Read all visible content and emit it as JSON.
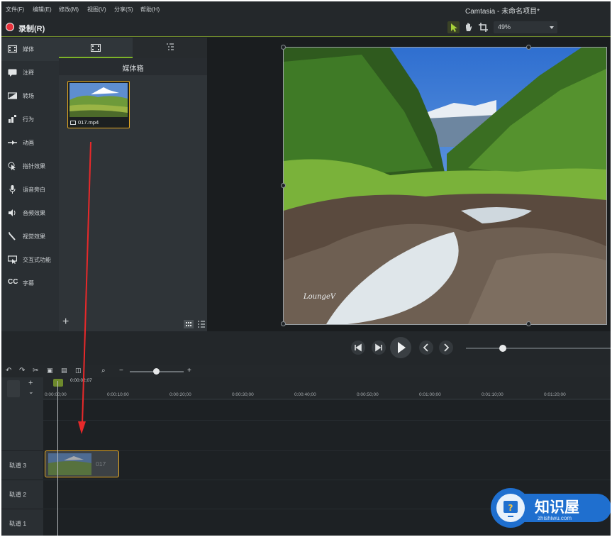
{
  "menubar": {
    "items": [
      "文件(F)",
      "编辑(E)",
      "修改(M)",
      "视图(V)",
      "分享(S)",
      "帮助(H)"
    ],
    "title": "Camtasia - 未命名项目*"
  },
  "toolbar": {
    "record_label": "录制(R)",
    "zoom_value": "49%"
  },
  "sidebar": {
    "items": [
      {
        "label": "媒体",
        "icon": "film-icon"
      },
      {
        "label": "注释",
        "icon": "annotation-icon"
      },
      {
        "label": "转场",
        "icon": "transition-icon"
      },
      {
        "label": "行为",
        "icon": "behavior-icon"
      },
      {
        "label": "动画",
        "icon": "animation-icon"
      },
      {
        "label": "指针效果",
        "icon": "cursor-effect-icon"
      },
      {
        "label": "语音旁白",
        "icon": "microphone-icon"
      },
      {
        "label": "音频效果",
        "icon": "speaker-icon"
      },
      {
        "label": "视觉效果",
        "icon": "magic-wand-icon"
      },
      {
        "label": "交互式功能",
        "icon": "interactive-icon"
      },
      {
        "label": "字幕",
        "icon": "cc-icon"
      }
    ]
  },
  "media_bin": {
    "header": "媒体箱",
    "clip_name": "017.mp4"
  },
  "preview": {
    "watermark": "LoungeV"
  },
  "timeline": {
    "playhead_time": "0:00:02;07",
    "ticks": [
      "0:00:00;00",
      "0:00:10;00",
      "0:00:20;00",
      "0:00:30;00",
      "0:00:40;00",
      "0:00:50;00",
      "0:01:00;00",
      "0:01:10;00",
      "0:01:20;00"
    ],
    "tracks": [
      "轨道 3",
      "轨道 2",
      "轨道 1"
    ],
    "clip_label": "017"
  },
  "logo": {
    "name": "知识屋",
    "url": "zhishiwu.com"
  },
  "colors": {
    "accent_green": "#7db328",
    "clip_border": "#e6a921",
    "record_red": "#e8323c",
    "annotation_arrow": "#e8292a"
  }
}
